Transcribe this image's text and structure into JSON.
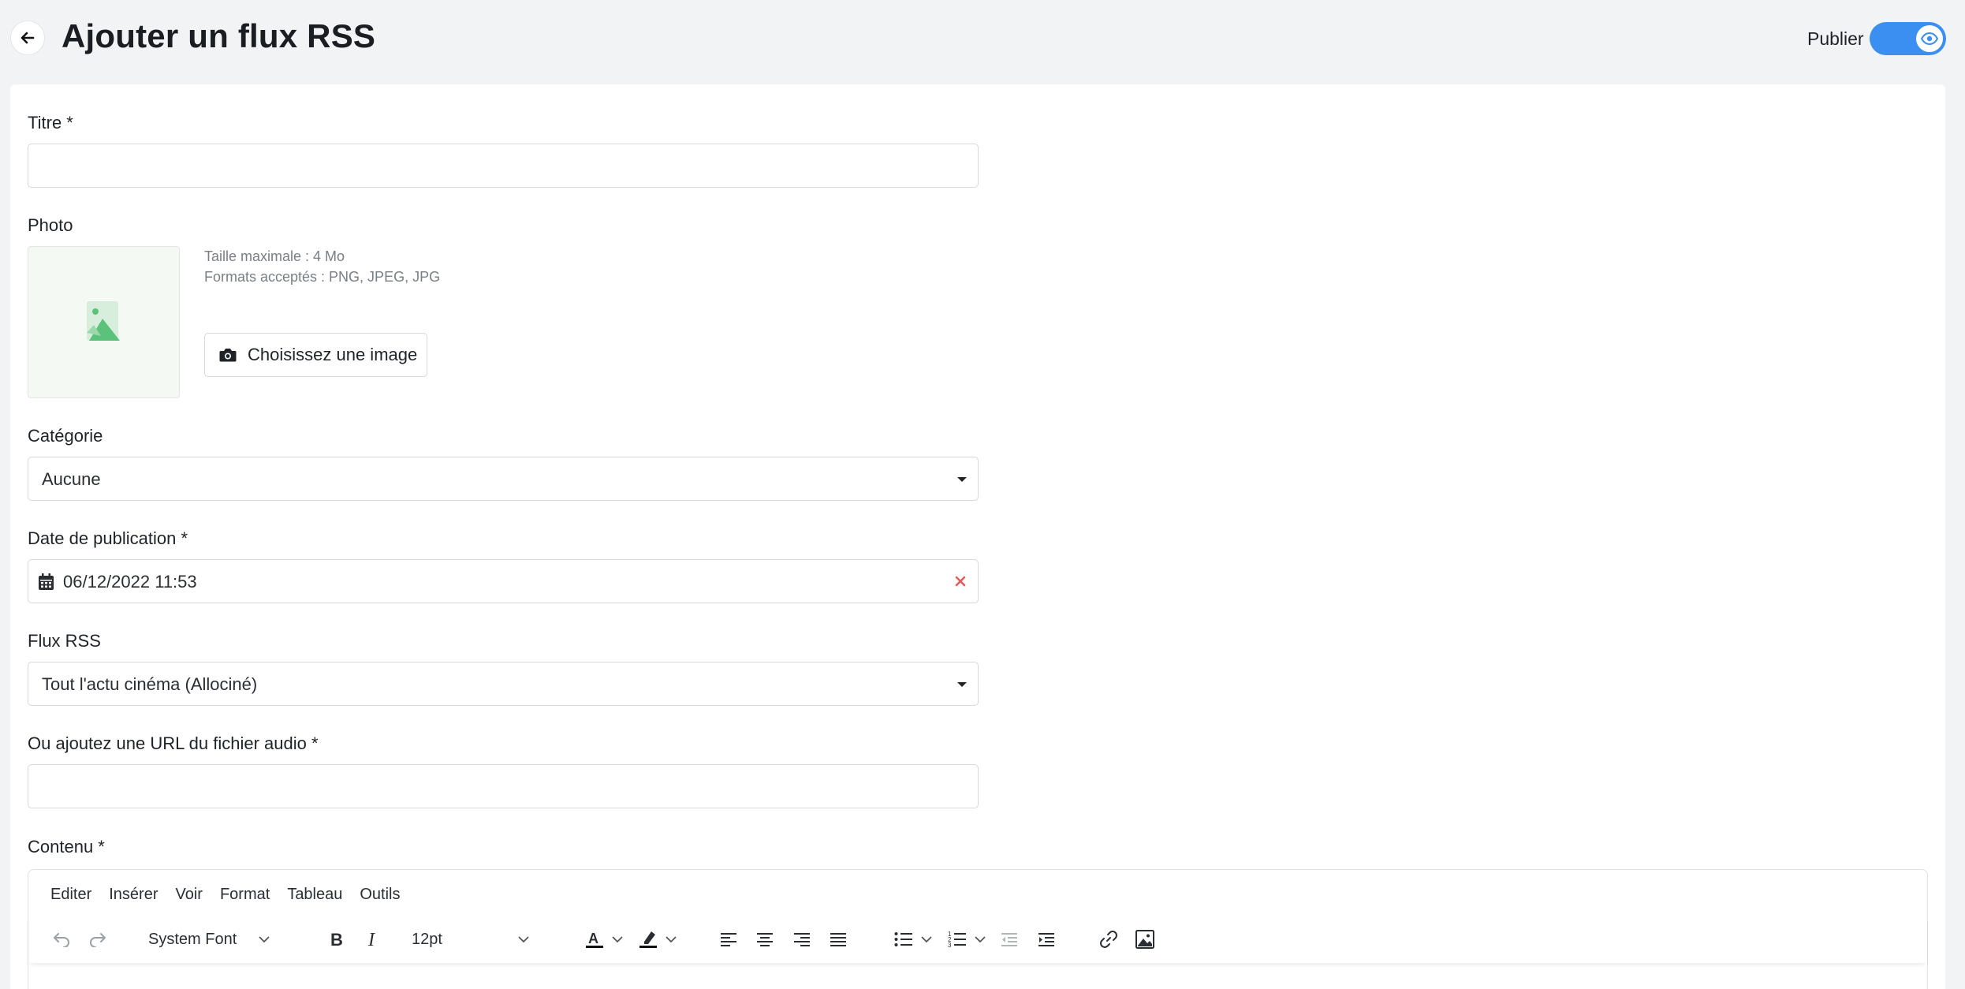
{
  "header": {
    "title": "Ajouter un flux RSS",
    "publish_label": "Publier",
    "publish_on": true,
    "accent_color": "#3b8ff0"
  },
  "form": {
    "title_label": "Titre *",
    "title_value": "",
    "photo_label": "Photo",
    "photo_hint_size": "Taille maximale : 4 Mo",
    "photo_hint_formats": "Formats acceptés : PNG, JPEG, JPG",
    "choose_image_label": "Choisissez une image",
    "category_label": "Catégorie",
    "category_value": "Aucune",
    "date_label": "Date de publication *",
    "date_value": "06/12/2022 11:53",
    "rss_label": "Flux RSS",
    "rss_value": "Tout l'actu cinéma (Allociné)",
    "audio_url_label": "Ou ajoutez une URL du fichier audio *",
    "audio_url_value": "",
    "content_label": "Contenu *"
  },
  "editor": {
    "menu": [
      "Editer",
      "Insérer",
      "Voir",
      "Format",
      "Tableau",
      "Outils"
    ],
    "font_family": "System Font",
    "font_size": "12pt",
    "icons": [
      "undo-icon",
      "redo-icon",
      "bold-icon",
      "italic-icon",
      "text-color-icon",
      "highlight-icon",
      "align-left-icon",
      "align-center-icon",
      "align-right-icon",
      "align-justify-icon",
      "bullet-list-icon",
      "numbered-list-icon",
      "outdent-icon",
      "indent-icon",
      "link-icon",
      "image-icon"
    ]
  }
}
